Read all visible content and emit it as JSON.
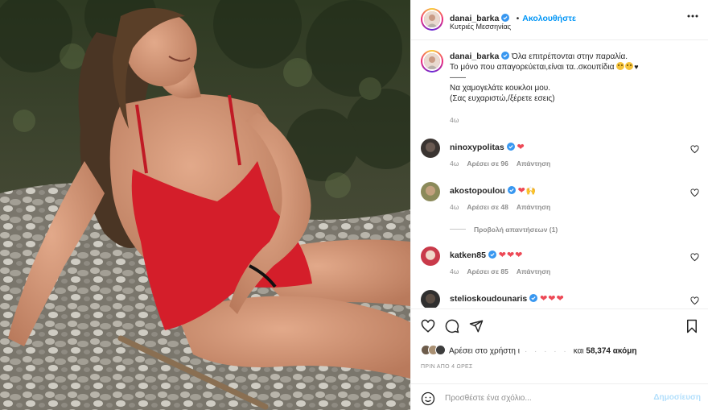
{
  "post": {
    "username": "danai_barka",
    "follow_label": "Ακολουθήστε",
    "location": "Κυτριές Μεσσηνίας",
    "caption_lines": [
      "Όλα επιτρέπονται στην παραλία.",
      "Το μόνο που απαγορεύεται,είναι τα..σκουπίδια",
      "——",
      "Να χαμογελάτε κουκλοι μου.",
      "(Σας ευχαριστώ,/ξέρετε εσεις)"
    ],
    "caption_time": "4ω"
  },
  "comments": [
    {
      "user": "ninoxypolitas",
      "time": "4ω",
      "likes": "Αρέσει σε 96",
      "reply": "Απάντηση",
      "avatar_color": "#3a3431"
    },
    {
      "user": "akostopoulou",
      "time": "4ω",
      "likes": "Αρέσει σε 48",
      "reply": "Απάντηση",
      "avatar_color": "#8b8a5a"
    },
    {
      "user": "katken85",
      "time": "4ω",
      "likes": "Αρέσει σε 85",
      "reply": "Απάντηση",
      "avatar_color": "#c93a4a"
    },
    {
      "user": "stelioskoudounaris",
      "avatar_color": "#2f2f2f"
    }
  ],
  "view_replies": "Προβολή απαντήσεων (1)",
  "likes_summary": {
    "prefix": "Αρέσει στο χρήστη ι",
    "hidden": "· · · · ·",
    "connector": "και",
    "count": "58,374 ακόμη"
  },
  "post_time": "ΠΡΙΝ ΑΠΟ 4 ΩΡΕΣ",
  "comment_box": {
    "placeholder": "Προσθέστε ένα σχόλιο...",
    "post_label": "Δημοσίευση"
  },
  "icons": {
    "more": "more-options-icon",
    "verified": "verified-badge-icon",
    "like": "heart-icon",
    "comment": "comment-icon",
    "share": "share-icon",
    "save": "bookmark-icon",
    "emoji": "emoji-icon"
  },
  "colors": {
    "accent": "#0095f6",
    "heart": "#ed4956",
    "muted": "#8e8e8e",
    "swimsuit": "#d41e2a"
  }
}
